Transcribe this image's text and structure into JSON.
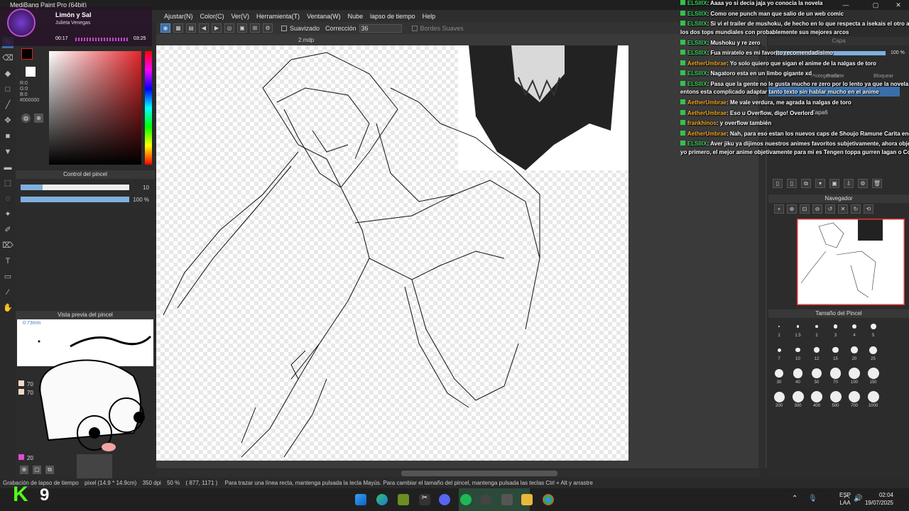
{
  "window": {
    "title": "MediBang Paint Pro (64bit)",
    "doc_name": "2.mdp",
    "min": "—",
    "max": "▢",
    "close": "✕"
  },
  "menu": [
    "Ajustar(N)",
    "Color(C)",
    "Ver(V)",
    "Herramienta(T)",
    "Ventana(W)",
    "Nube",
    "lapso de tiempo",
    "Help"
  ],
  "music": {
    "song": "Limón y Sal",
    "artist": "Julieta Venegas",
    "elapsed": "00:17",
    "total": "03:25"
  },
  "tool_options": {
    "smoothing_label": "Suavizado",
    "correction_label": "Corrección",
    "correction_value": "36",
    "soft_edges_label": "Bordes Suaves"
  },
  "color": {
    "r": "R:0",
    "g": "G:0",
    "b": "B:0",
    "hex": "#000000",
    "fg": "#000000",
    "bg": "#ffffff"
  },
  "brush_control": {
    "title": "Control del pincel",
    "size_value": "10",
    "opacity_value": "100 %",
    "size_fraction": 0.2,
    "opacity_fraction": 1.0
  },
  "brush_preview": {
    "title": "Vista previa del pincel",
    "size_text": "0.73mm"
  },
  "layers": {
    "opacity_values": [
      "70",
      "70",
      "20"
    ]
  },
  "layer_panel": {
    "title": "Capa",
    "opacity": "100 %",
    "protect_alpha": "Proteger alfa",
    "clip": "Recorte",
    "lock": "Bloquear",
    "layer_name": "Capa6"
  },
  "navigator": {
    "title": "Navegador"
  },
  "brush_size_panel": {
    "title": "Tamaño del Pincel",
    "sizes": [
      "1",
      "1.5",
      "2",
      "3",
      "4",
      "5",
      "7",
      "10",
      "12",
      "15",
      "20",
      "25",
      "30",
      "40",
      "50",
      "70",
      "100",
      "150",
      "200",
      "300",
      "400",
      "500",
      "700",
      "1000"
    ]
  },
  "chat": [
    {
      "user": "ELSIIIX",
      "text": ": Aaaa yo si decia jaja yo conocia la novela",
      "color": "green"
    },
    {
      "user": "ELSIIIX",
      "text": ": Como one punch man que salio de un web comic",
      "color": "green"
    },
    {
      "user": "ELSIIIX",
      "text": ": Si vi el trailer de mushoku, de hecho en lo que respecta a isekais el otro año",
      "cont": "los dos tops mundiales con probablemente sus mejores arcos",
      "color": "green"
    },
    {
      "user": "ELSIIIX",
      "text": ": Mushoku y re zero",
      "color": "green"
    },
    {
      "user": "ELSIIIX",
      "text": ": Fua miratelo es mi favorito recomendadisimo",
      "color": "green"
    },
    {
      "user": "AetherUmbrae",
      "text": ": Yo solo quiero que sigan el anime de la nalgas de toro",
      "color": "orange"
    },
    {
      "user": "ELSIIIX",
      "text": ": Nagatoro esta en un limbo gigante xd",
      "color": "green"
    },
    {
      "user": "ELSIIIX",
      "text": ": Pasa que la gente no le gusta mucho re zero por lo lento ya que la novela es",
      "cont": "entons esta complicado adaptar tanto texto sin hablar mucho en el anime",
      "color": "green"
    },
    {
      "user": "AetherUmbrae",
      "text": ": Me vale verdura, me agrada la nalgas de toro",
      "color": "orange"
    },
    {
      "user": "AetherUmbrae",
      "text": ": Eso u Overflow, digo! Overlord",
      "color": "orange"
    },
    {
      "user": "frankhinos",
      "text": ": y overflow también",
      "color": "orange"
    },
    {
      "user": "AetherUmbrae",
      "text": ": Nah, para eso estan los nuevos caps de Shoujo Ramune Carita endial",
      "color": "orange"
    },
    {
      "user": "ELSIIIX",
      "text": ": Aver jiku ya dijimos nuestros animes favoritos subjetivamente, ahora objetiv",
      "cont": "yo primero, el mejor anime objetivamente para mi es Tengen toppa gurren lagan o Code",
      "color": "green"
    }
  ],
  "status": {
    "left": "Grabación de lapso de tiempo",
    "px": "pixel  (14.9 * 14.9cm)",
    "dpi": "350 dpi",
    "zoom": "50 %",
    "coords": "( 877, 1171 )",
    "hint": "Para trazar una línea recta, mantenga pulsada la tecla Mayús. Para cambiar el tamaño del pincel, mantenga pulsada las teclas Ctrl + Alt y arrastre"
  },
  "kick": {
    "logo": "K",
    "count": "9"
  },
  "taskbar": {
    "lang1": "ESP",
    "lang2": "LAA",
    "time": "02:04",
    "date": "19/07/2025"
  }
}
